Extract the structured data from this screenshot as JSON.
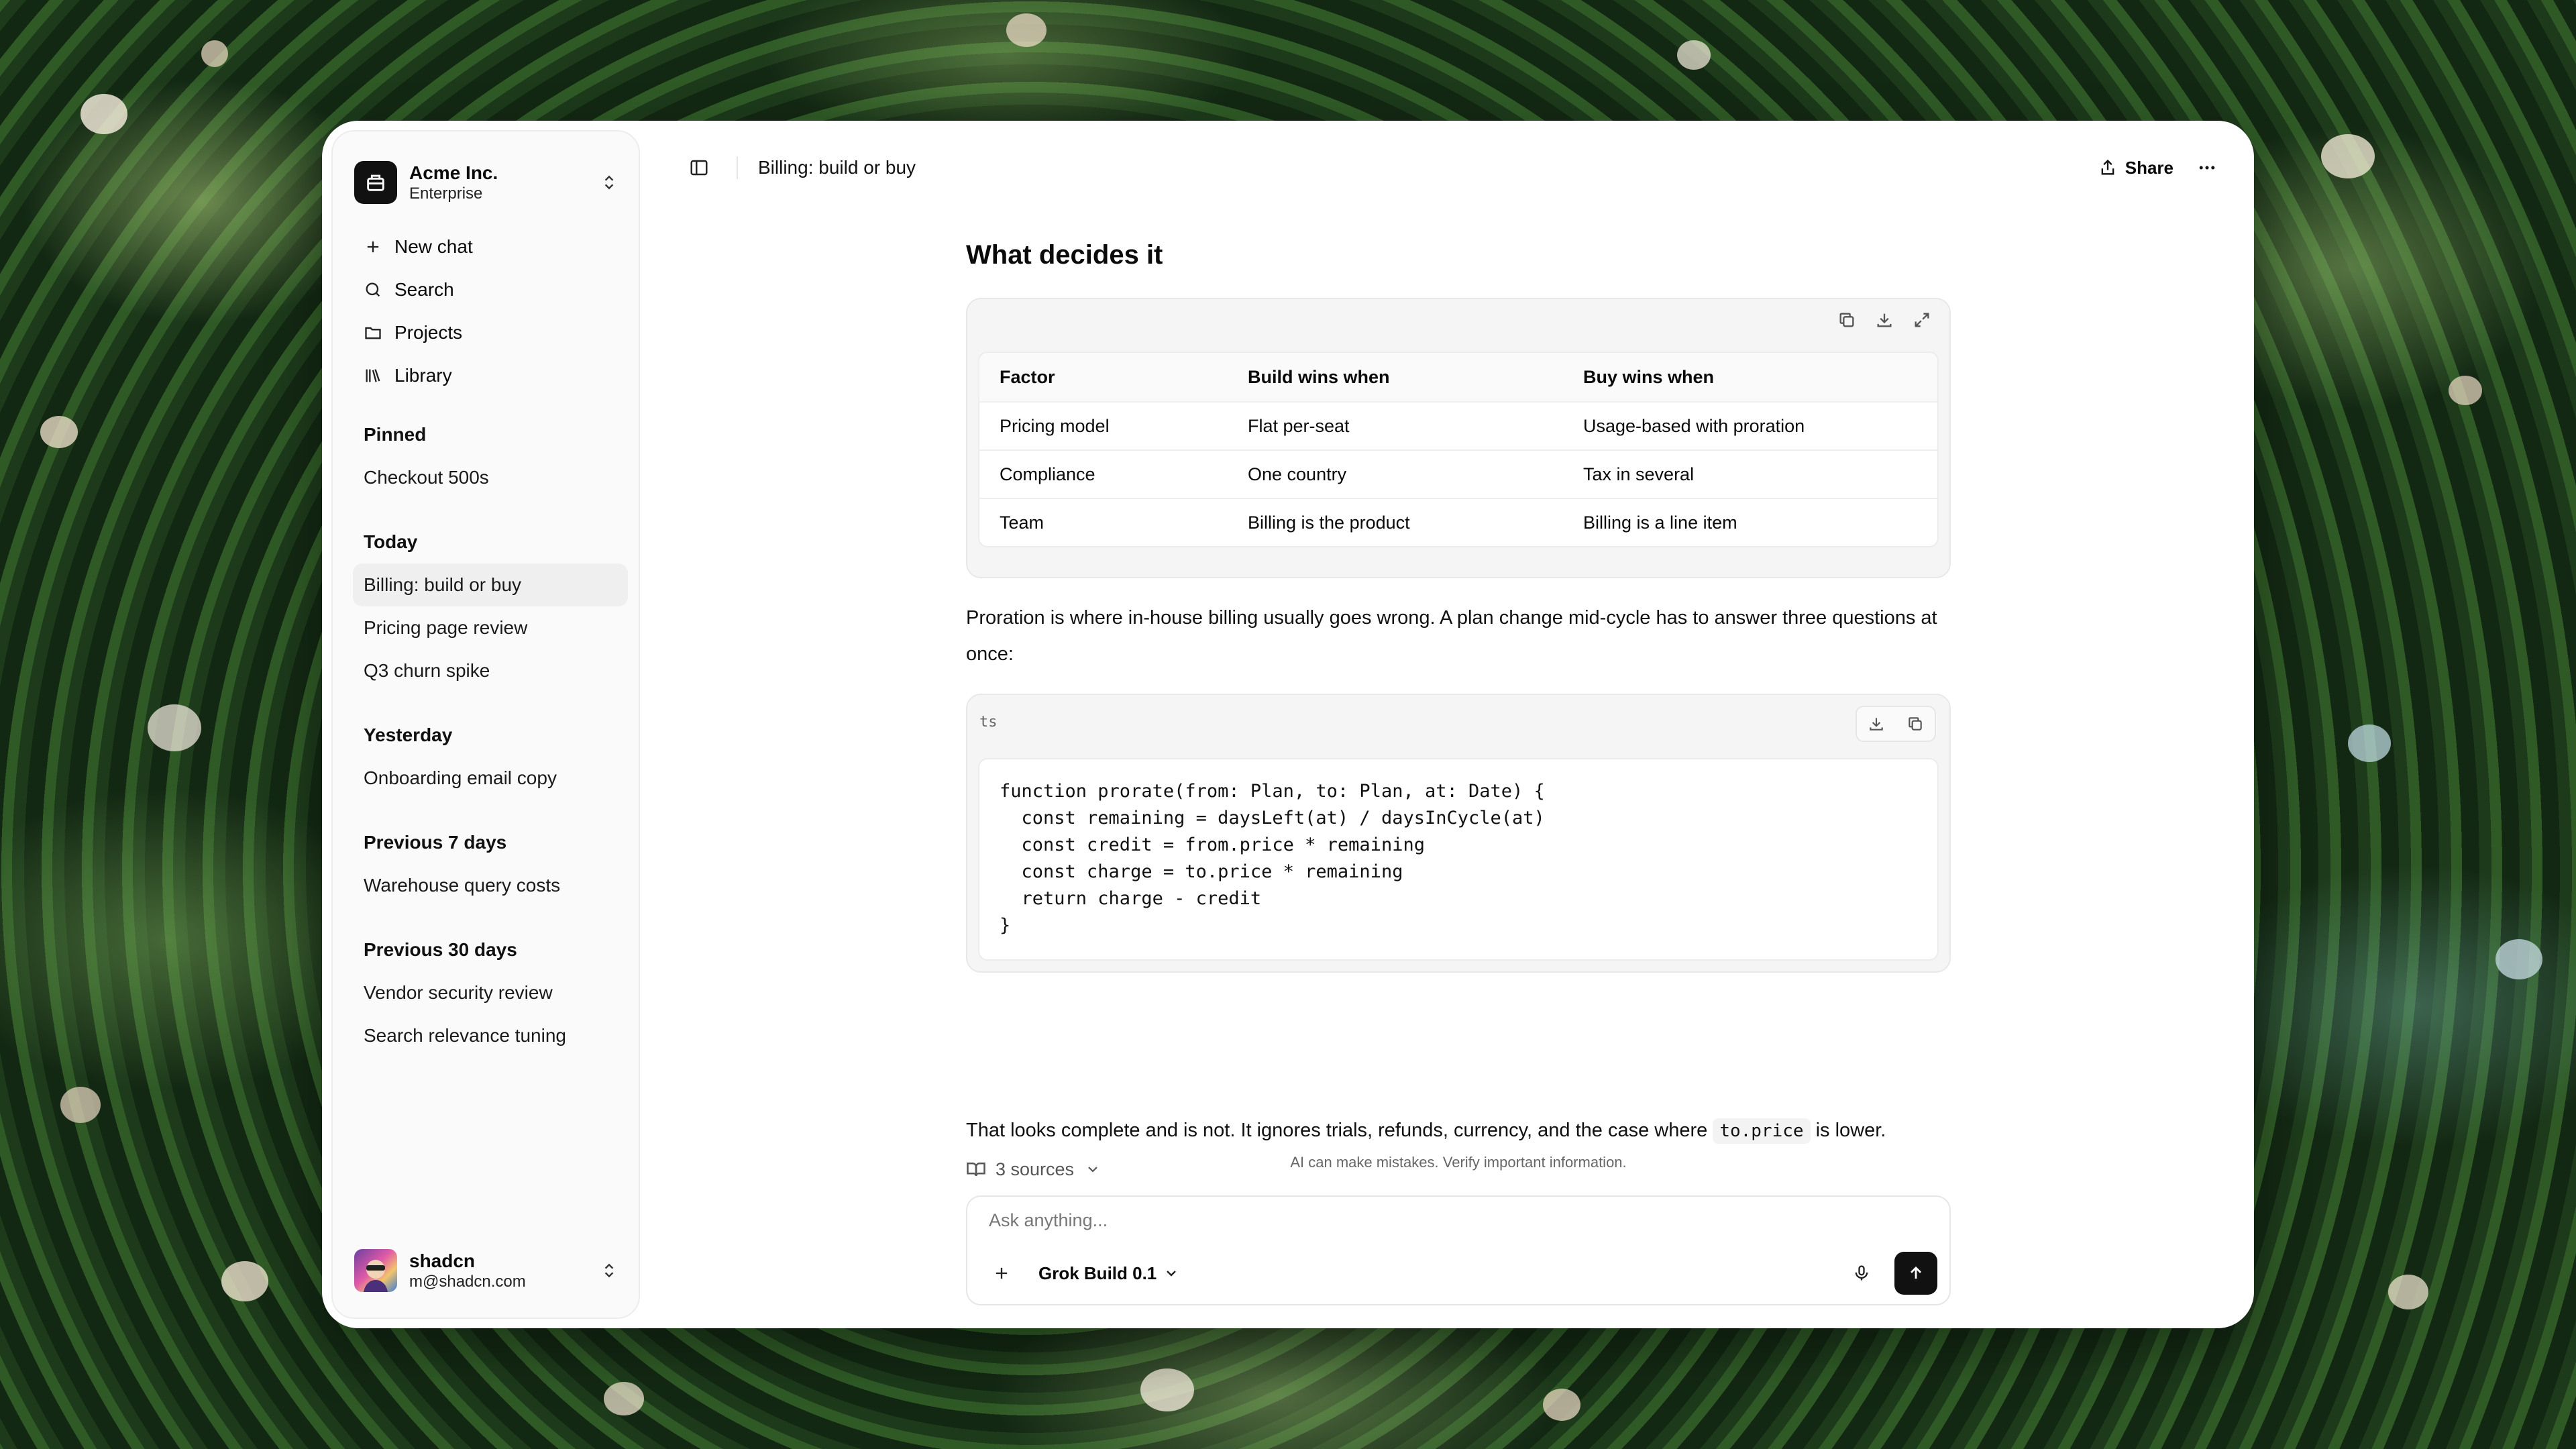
{
  "org": {
    "name": "Acme Inc.",
    "plan": "Enterprise"
  },
  "nav": [
    {
      "label": "New chat",
      "icon": "plus-icon"
    },
    {
      "label": "Search",
      "icon": "search-icon"
    },
    {
      "label": "Projects",
      "icon": "folder-icon"
    },
    {
      "label": "Library",
      "icon": "library-icon"
    }
  ],
  "history": {
    "pinned": {
      "title": "Pinned",
      "items": [
        "Checkout 500s"
      ]
    },
    "today": {
      "title": "Today",
      "items": [
        "Billing: build or buy",
        "Pricing page review",
        "Q3 churn spike"
      ]
    },
    "yesterday": {
      "title": "Yesterday",
      "items": [
        "Onboarding email copy"
      ]
    },
    "prev7": {
      "title": "Previous 7 days",
      "items": [
        "Warehouse query costs"
      ]
    },
    "prev30": {
      "title": "Previous 30 days",
      "items": [
        "Vendor security review",
        "Search relevance tuning"
      ]
    }
  },
  "user": {
    "name": "shadcn",
    "email": "m@shadcn.com"
  },
  "header": {
    "title": "Billing: build or buy",
    "share_label": "Share"
  },
  "message": {
    "heading": "What decides it",
    "table": {
      "columns": [
        "Factor",
        "Build wins when",
        "Buy wins when"
      ],
      "rows": [
        [
          "Pricing model",
          "Flat per-seat",
          "Usage-based with proration"
        ],
        [
          "Compliance",
          "One country",
          "Tax in several"
        ],
        [
          "Team",
          "Billing is the product",
          "Billing is a line item"
        ]
      ]
    },
    "para1": "Proration is where in-house billing usually goes wrong. A plan change mid-cycle has to answer three questions at once:",
    "code": {
      "lang": "ts",
      "lines": [
        "function prorate(from: Plan, to: Plan, at: Date) {",
        "  const remaining = daysLeft(at) / daysInCycle(at)",
        "  const credit = from.price * remaining",
        "  const charge = to.price * remaining",
        "  return charge - credit",
        "}"
      ]
    },
    "para2_before": "That looks complete and is not. It ignores trials, refunds, currency, and the case where",
    "para2_code": "to.price",
    "para2_after": "is lower.",
    "sources_label": "3 sources"
  },
  "composer": {
    "disclaimer": "AI can make mistakes. Verify important information.",
    "placeholder": "Ask anything...",
    "model": "Grok Build 0.1"
  }
}
